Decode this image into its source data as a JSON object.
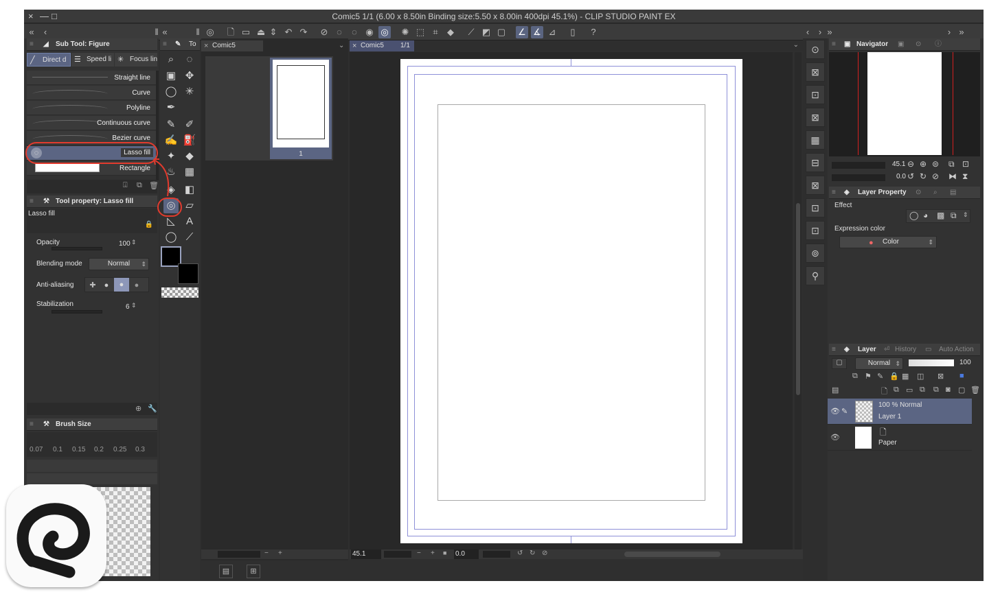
{
  "window": {
    "title": "Comic5 1/1 (6.00 x 8.50in Binding size:5.50 x 8.00in 400dpi 45.1%)  - CLIP STUDIO PAINT EX",
    "close_icon": "×",
    "minimize_icon": "—",
    "maximize_icon": "□"
  },
  "sub_tool_panel": {
    "title": "Sub Tool: Figure",
    "tabs": [
      "Direct d",
      "Speed li",
      "Focus lin"
    ],
    "items": [
      "Straight line",
      "Curve",
      "Polyline",
      "Continuous curve",
      "Bezier curve",
      "Lasso fill",
      "Rectangle"
    ],
    "selected": "Lasso fill"
  },
  "tool_property": {
    "title": "Tool property: Lasso fill",
    "tool_name": "Lasso fill",
    "opacity_label": "Opacity",
    "opacity_value": "100",
    "blending_label": "Blending mode",
    "blending_value": "Normal",
    "antialias_label": "Anti-aliasing",
    "stabilization_label": "Stabilization",
    "stabilization_value": "6"
  },
  "brush_size": {
    "title": "Brush Size",
    "sizes": [
      "0.07",
      "0.1",
      "0.15",
      "0.2",
      "0.25",
      "0.3"
    ]
  },
  "tool_palette": {
    "header": "To"
  },
  "page_manager": {
    "tab": "Comic5",
    "page_number": "1"
  },
  "canvas": {
    "tab": "Comic5",
    "page": "1/1",
    "zoom": "45.1",
    "angle": "0.0"
  },
  "navigator": {
    "title": "Navigator",
    "zoom": "45.1",
    "angle": "0.0"
  },
  "layer_property": {
    "title": "Layer Property",
    "effect_label": "Effect",
    "expression_label": "Expression color",
    "expression_value": "Color"
  },
  "layer_panel": {
    "tabs": [
      "Layer",
      "History",
      "Auto Action"
    ],
    "blend_mode": "Normal",
    "opacity": "100",
    "layers": [
      {
        "info": "100 %  Normal",
        "name": "Layer 1"
      },
      {
        "info": "",
        "name": "Paper"
      }
    ]
  },
  "colors": {
    "accent": "#5b6583",
    "annotation": "#e23b2e",
    "panel": "#323232",
    "canvas_bg": "#282828"
  }
}
